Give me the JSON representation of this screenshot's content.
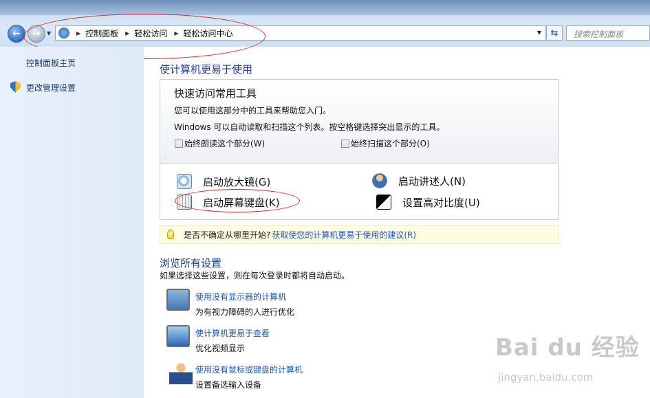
{
  "address_bar": {
    "breadcrumbs": [
      "控制面板",
      "轻松访问",
      "轻松访问中心"
    ],
    "search_placeholder": "搜索控制面板"
  },
  "sidebar": {
    "items": [
      {
        "label": "控制面板主页"
      },
      {
        "label": "更改管理设置",
        "icon": "shield-icon"
      }
    ]
  },
  "main": {
    "title": "使计算机更易于使用",
    "quick_access": {
      "title": "快速访问常用工具",
      "desc1": "您可以使用这部分中的工具来帮助您入门。",
      "desc2": "Windows 可以自动读取和扫描这个列表。按空格键选择突出显示的工具。",
      "check_read": "始终朗读这个部分(W)",
      "check_scan": "始终扫描这个部分(O)",
      "tools": {
        "magnifier": "启动放大镜(G)",
        "narrator": "启动讲述人(N)",
        "keyboard": "启动屏幕键盘(K)",
        "contrast": "设置高对比度(U)"
      }
    },
    "tip": {
      "text": "是否不确定从哪里开始?",
      "link": "获取使您的计算机更易于使用的建议(R)"
    },
    "browse": {
      "title": "浏览所有设置",
      "desc": "如果选择这些设置，则在每次登录时都将自动启动。",
      "items": [
        {
          "link": "使用没有显示器的计算机",
          "sub": "为有视力障碍的人进行优化"
        },
        {
          "link": "使计算机更易于查看",
          "sub": "优化视频显示"
        },
        {
          "link": "使用没有鼠标或键盘的计算机",
          "sub": "设置备选输入设备"
        }
      ]
    }
  },
  "watermark": {
    "logo_text": "Bai du 经验",
    "url": "jingyan.baidu.com"
  },
  "colors": {
    "accent_link": "#1a56b3",
    "heading": "#1e3b8a",
    "annotation_red": "#d42a2a"
  }
}
